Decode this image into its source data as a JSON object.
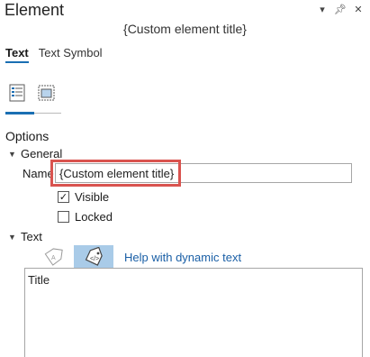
{
  "pane": {
    "title": "Element",
    "subtitle": "{Custom element title}",
    "control_icons": [
      "dropdown-icon",
      "pin-icon",
      "close-icon"
    ]
  },
  "tabs": [
    {
      "label": "Text",
      "active": true
    },
    {
      "label": "Text Symbol",
      "active": false
    }
  ],
  "sub_tabs": [
    {
      "icon": "text-properties-icon",
      "active": true
    },
    {
      "icon": "placement-icon",
      "active": false
    }
  ],
  "options": {
    "header": "Options",
    "general": {
      "header": "General",
      "name_label": "Name",
      "name_value": "{Custom element title}",
      "visible_label": "Visible",
      "visible_checked": true,
      "locked_label": "Locked",
      "locked_checked": false
    },
    "text": {
      "header": "Text",
      "help_link": "Help with dynamic text",
      "content": "Title"
    }
  },
  "colors": {
    "accent": "#1a6fb3",
    "highlight": "#d9534f",
    "dynamic_button_bg": "#a9cbe8",
    "link": "#1a5fa6"
  }
}
